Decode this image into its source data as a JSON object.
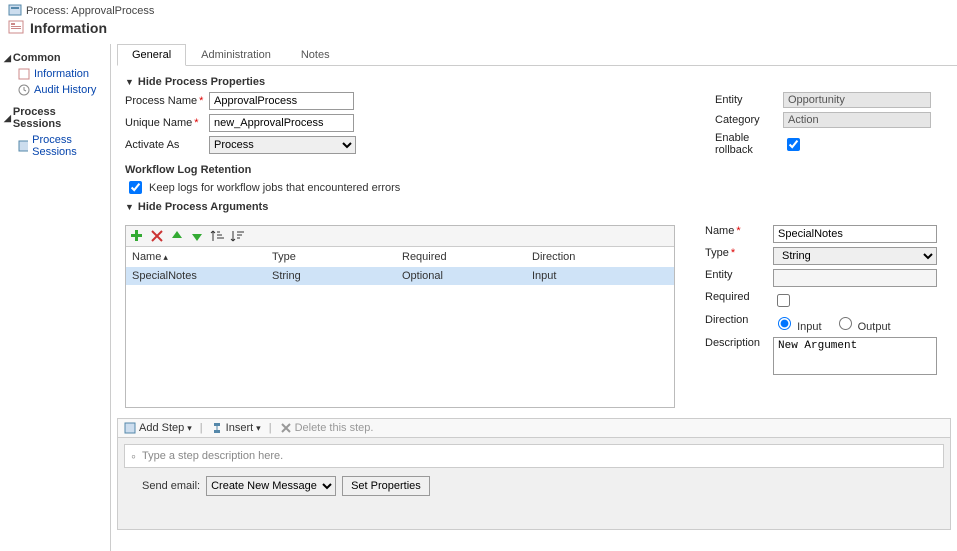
{
  "header": {
    "process_line": "Process: ApprovalProcess",
    "title": "Information"
  },
  "sidebar": {
    "common": "Common",
    "information": "Information",
    "audit_history": "Audit History",
    "process_sessions_group": "Process Sessions",
    "process_sessions_item": "Process Sessions"
  },
  "tabs": {
    "general": "General",
    "administration": "Administration",
    "notes": "Notes"
  },
  "properties": {
    "header": "Hide Process Properties",
    "process_name_label": "Process Name",
    "process_name_value": "ApprovalProcess",
    "unique_name_label": "Unique Name",
    "unique_name_value": "new_ApprovalProcess",
    "activate_as_label": "Activate As",
    "activate_as_value": "Process",
    "entity_label": "Entity",
    "entity_value": "Opportunity",
    "category_label": "Category",
    "category_value": "Action",
    "enable_rollback_label": "Enable rollback",
    "log_retention_heading": "Workflow Log Retention",
    "keep_logs_label": "Keep logs for workflow jobs that encountered errors"
  },
  "arguments": {
    "header": "Hide Process Arguments",
    "grid_headers": {
      "name": "Name",
      "type": "Type",
      "required": "Required",
      "direction": "Direction"
    },
    "rows": [
      {
        "name": "SpecialNotes",
        "type": "String",
        "required": "Optional",
        "direction": "Input"
      }
    ],
    "form": {
      "name_label": "Name",
      "name_value": "SpecialNotes",
      "type_label": "Type",
      "type_value": "String",
      "entity_label": "Entity",
      "entity_value": "",
      "required_label": "Required",
      "direction_label": "Direction",
      "direction_input": "Input",
      "direction_output": "Output",
      "description_label": "Description",
      "description_value": "New Argument"
    }
  },
  "steps": {
    "add_step": "Add Step",
    "insert": "Insert",
    "delete": "Delete this step.",
    "desc_placeholder": "Type a step description here.",
    "send_email_label": "Send email:",
    "send_email_option": "Create New Message",
    "set_properties": "Set Properties"
  }
}
